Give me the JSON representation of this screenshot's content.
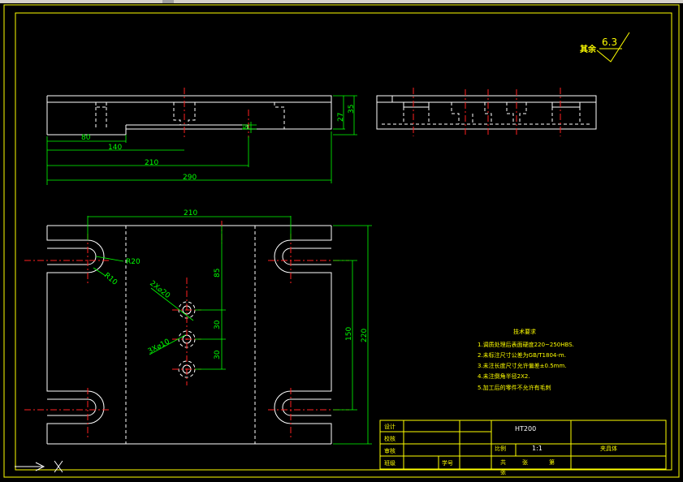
{
  "roughness": {
    "label": "其余",
    "value": "6.3"
  },
  "dims": {
    "front": {
      "d80": "80",
      "d140": "140",
      "d210": "210",
      "d290": "290",
      "d27": "27",
      "d35": "35",
      "d5": "5"
    },
    "plan": {
      "d210": "210",
      "d85": "85",
      "d30a": "30",
      "d30b": "30",
      "d150": "150",
      "d220": "220",
      "r20": "R20",
      "r10": "R10",
      "holes_a": "2X⌀20",
      "holes_b": "3X⌀10"
    }
  },
  "tech": {
    "title": "技术要求",
    "items": [
      "1.调质处理后表面硬度220~250HBS.",
      "2.未标注尺寸公差为GB/T1804-m.",
      "3.未注长度尺寸允许偏差±0.5mm.",
      "4.未注倒角半径2X2.",
      "5.加工后的零件不允许有毛刺"
    ]
  },
  "title_block": {
    "design": "设计",
    "check": "校核",
    "review": "审核",
    "class": "班级",
    "student_no": "学号",
    "material": "HT200",
    "scale_label": "比例",
    "scale_value": "1:1",
    "part_name": "夹具体",
    "total": "共",
    "sheets": "张",
    "page": "第",
    "sheet_no": "张"
  }
}
